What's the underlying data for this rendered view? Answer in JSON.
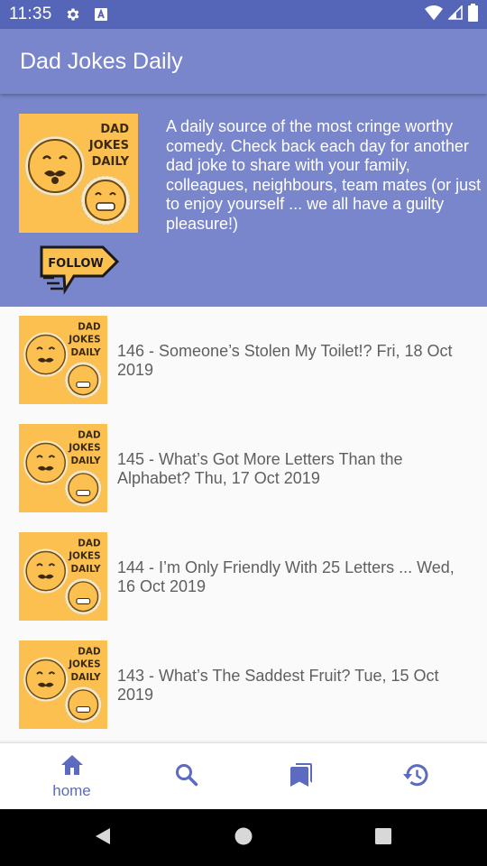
{
  "status_bar": {
    "time": "11:35"
  },
  "app_bar": {
    "title": "Dad Jokes Daily"
  },
  "header": {
    "cover_text": [
      "DAD",
      "JOKES",
      "DAILY"
    ],
    "follow_label": "FOLLOW",
    "description": "A daily source of the most cringe worthy comedy. Check back each day for another dad joke to share with your family, colleagues, neighbours, team mates (or just to enjoy yourself ... we all have a guilty pleasure!)"
  },
  "episodes": [
    {
      "title": "146 - Someone’s Stolen My Toilet!? Fri, 18 Oct 2019"
    },
    {
      "title": "145 - What’s Got More Letters Than the Alphabet? Thu, 17 Oct 2019"
    },
    {
      "title": "144 - I’m Only Friendly With 25 Letters ... Wed, 16 Oct 2019"
    },
    {
      "title": "143 - What’s The Saddest Fruit? Tue, 15 Oct 2019"
    }
  ],
  "bottom_nav": {
    "items": [
      {
        "icon": "home-icon",
        "label": "home",
        "active": true
      },
      {
        "icon": "search-icon",
        "label": "",
        "active": false
      },
      {
        "icon": "bookmarks-icon",
        "label": "",
        "active": false
      },
      {
        "icon": "history-icon",
        "label": "",
        "active": false
      }
    ]
  },
  "colors": {
    "primary": "#7986cb",
    "primary_dark": "#5565b8",
    "accent": "#5c6bc0",
    "cover_yellow": "#fbc04f"
  }
}
